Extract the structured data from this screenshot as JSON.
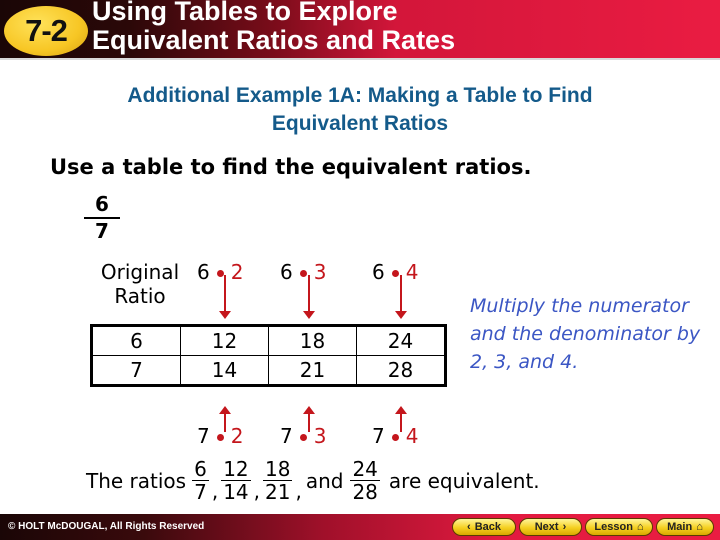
{
  "header": {
    "lesson_badge": "7-2",
    "title_line1": "Using Tables to Explore",
    "title_line2": "Equivalent Ratios and Rates"
  },
  "example": {
    "title_line1": "Additional Example 1A: Making a Table to Find",
    "title_line2": "Equivalent Ratios",
    "prompt": "Use a table to find the equivalent ratios.",
    "given_ratio": {
      "numerator": "6",
      "denominator": "7"
    }
  },
  "table": {
    "label_line1": "Original",
    "label_line2": "Ratio",
    "top_multipliers": [
      {
        "base": "6",
        "factor": "2"
      },
      {
        "base": "6",
        "factor": "3"
      },
      {
        "base": "6",
        "factor": "4"
      }
    ],
    "bottom_multipliers": [
      {
        "base": "7",
        "factor": "2"
      },
      {
        "base": "7",
        "factor": "3"
      },
      {
        "base": "7",
        "factor": "4"
      }
    ],
    "rows": [
      [
        "6",
        "12",
        "18",
        "24"
      ],
      [
        "7",
        "14",
        "21",
        "28"
      ]
    ]
  },
  "note": "Multiply the numerator and the denominator by 2, 3, and 4.",
  "conclusion": {
    "prefix": "The ratios",
    "fractions": [
      {
        "n": "6",
        "d": "7",
        "sep": ","
      },
      {
        "n": "12",
        "d": "14",
        "sep": ","
      },
      {
        "n": "18",
        "d": "21",
        "sep": ","
      }
    ],
    "and": "and",
    "last": {
      "n": "24",
      "d": "28"
    },
    "suffix": "are equivalent."
  },
  "footer": {
    "copyright": "© HOLT McDOUGAL, All Rights Reserved",
    "buttons": {
      "back": "Back",
      "next": "Next",
      "lesson": "Lesson",
      "main": "Main"
    }
  },
  "colors": {
    "accent_red": "#c4161c",
    "title_blue": "#145a8a",
    "note_blue": "#3b56c4",
    "badge_yellow": "#f7c624"
  }
}
